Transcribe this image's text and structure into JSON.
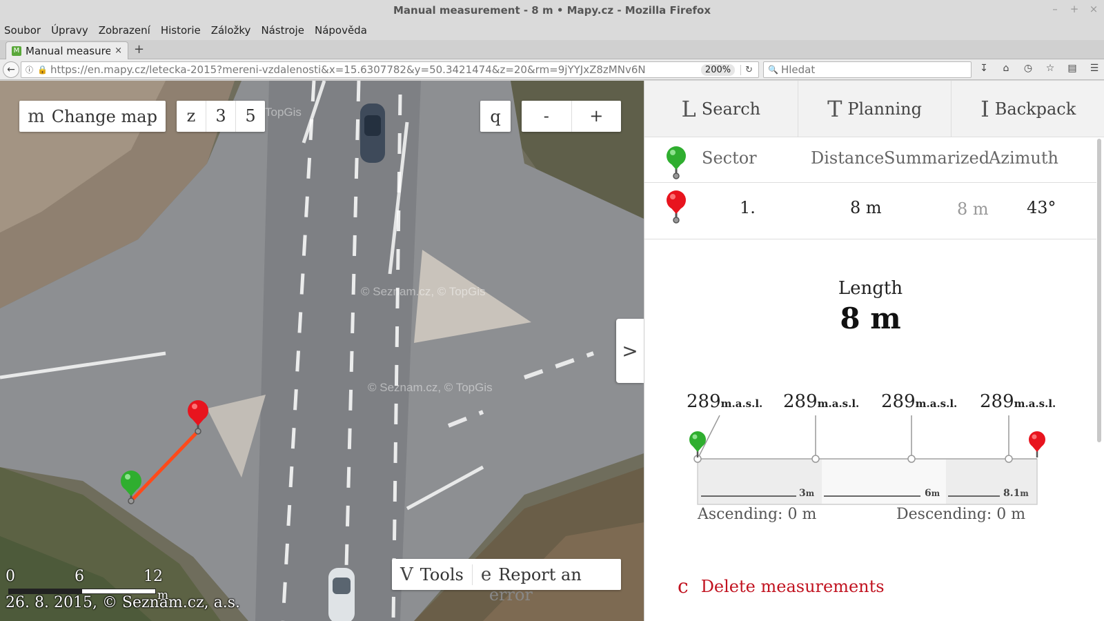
{
  "window": {
    "title": "Manual measurement - 8 m • Mapy.cz - Mozilla Firefox",
    "controls": [
      "–",
      "+",
      "×"
    ]
  },
  "menu": [
    "Soubor",
    "Úpravy",
    "Zobrazení",
    "Historie",
    "Záložky",
    "Nástroje",
    "Nápověda"
  ],
  "tab": {
    "title": "Manual measure",
    "close": "×",
    "new": "+"
  },
  "nav": {
    "url": "https://en.mapy.cz/letecka-2015?mereni-vzdalenosti&x=15.6307782&y=50.3421474&z=20&rm=9jYYJxZ8zMNv6N",
    "zoom": "200%",
    "search_placeholder": "Hledat",
    "icons": [
      "download-icon",
      "home-icon",
      "history-icon",
      "bookmark-star-icon",
      "reader-icon",
      "menu-icon"
    ]
  },
  "map": {
    "change_map_glyph": "m",
    "change_map_label": "Change map",
    "z_glyph": "z",
    "btn_3": "3",
    "btn_5": "5",
    "q_glyph": "q",
    "zoom_out": "-",
    "zoom_in": "+",
    "tools_glyph": "V",
    "tools_label": "Tools",
    "report_glyph": "e",
    "report_label": "Report an",
    "report_overflow": "error",
    "panel_toggle": ">",
    "watermark_1": "© Seznam.cz, © TopGis",
    "watermark_2": "© Seznam.cz, © TopGis",
    "watermark_3": "TopGis",
    "scale": {
      "labels": [
        "0",
        "6",
        "12"
      ],
      "unit": "m"
    },
    "copyright": "26. 8. 2015, © Seznam.cz, a.s.",
    "colors": {
      "measure_line": "#ff4a1a",
      "start_pin": "#2fae2f",
      "end_pin": "#e8141e"
    }
  },
  "panel": {
    "tabs": [
      {
        "glyph": "L",
        "label": "Search"
      },
      {
        "glyph": "T",
        "label": "Planning"
      },
      {
        "glyph": "I",
        "label": "Backpack"
      }
    ],
    "table": {
      "headers": {
        "sector": "Sector",
        "distance": "Distance",
        "summarized": "Summarized",
        "azimuth": "Azimuth"
      },
      "rows": [
        {
          "sector": "1.",
          "distance": "8 m",
          "summarized": "8 m",
          "azimuth": "43°"
        }
      ]
    },
    "length_label": "Length",
    "length_value": "8 m",
    "profile": {
      "altitudes": [
        {
          "value": "289",
          "unit": "m.a.s.l."
        },
        {
          "value": "289",
          "unit": "m.a.s.l."
        },
        {
          "value": "289",
          "unit": "m.a.s.l."
        },
        {
          "value": "289",
          "unit": "m.a.s.l."
        }
      ],
      "distances": [
        {
          "value": "3",
          "unit": "m"
        },
        {
          "value": "6",
          "unit": "m"
        },
        {
          "value": "8.1",
          "unit": "m"
        }
      ]
    },
    "ascending": "Ascending: 0 m",
    "descending": "Descending: 0 m",
    "delete_glyph": "c",
    "delete_label": "Delete measurements"
  }
}
